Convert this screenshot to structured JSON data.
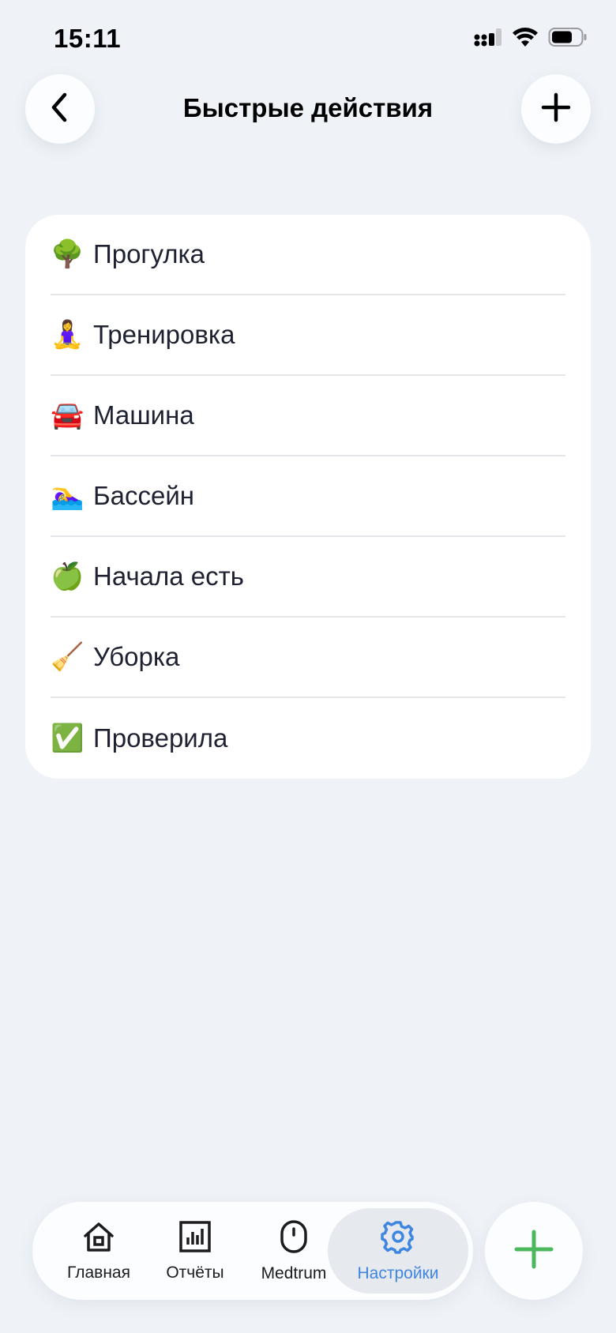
{
  "status_bar": {
    "time": "15:11",
    "icons": [
      "cellular-signal-icon",
      "wifi-icon",
      "battery-icon"
    ]
  },
  "header": {
    "title": "Быстрые действия",
    "back_icon": "chevron-left-icon",
    "add_icon": "plus-icon"
  },
  "actions": [
    {
      "emoji": "🌳",
      "label": "Прогулка"
    },
    {
      "emoji": "🧘‍♀️",
      "label": "Тренировка"
    },
    {
      "emoji": "🚘",
      "label": "Машина"
    },
    {
      "emoji": "🏊‍♀️",
      "label": "Бассейн"
    },
    {
      "emoji": "🍏",
      "label": "Начала есть"
    },
    {
      "emoji": "🧹",
      "label": "Уборка"
    },
    {
      "emoji": "✅",
      "label": "Проверила"
    }
  ],
  "tab_bar": {
    "tabs": [
      {
        "label": "Главная",
        "icon": "home-icon"
      },
      {
        "label": "Отчёты",
        "icon": "chart-icon"
      },
      {
        "label": "Medtrum",
        "icon": "sensor-icon"
      },
      {
        "label": "Настройки",
        "icon": "gear-icon"
      }
    ],
    "active_tab": 3
  },
  "fab": {
    "icon": "plus-icon"
  },
  "colors": {
    "background": "#eff3f7",
    "accent": "#3f86e0",
    "fab_plus": "#4cb85e"
  }
}
